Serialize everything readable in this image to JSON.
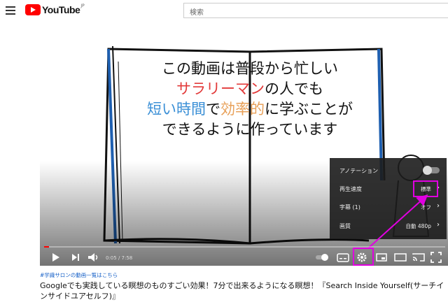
{
  "header": {
    "logo_text": "YouTube",
    "region": "JP",
    "search_placeholder": "検索"
  },
  "video": {
    "caption_lines": [
      [
        {
          "t": "この動画は普段から忙しい",
          "c": "black"
        }
      ],
      [
        {
          "t": "サラリーマン",
          "c": "red"
        },
        {
          "t": "の人でも",
          "c": "black"
        }
      ],
      [
        {
          "t": "短い時間",
          "c": "blue"
        },
        {
          "t": "で",
          "c": "black"
        },
        {
          "t": "効率的",
          "c": "orange"
        },
        {
          "t": "に学ぶことが",
          "c": "black"
        }
      ],
      [
        {
          "t": "できるように作っています",
          "c": "black"
        }
      ]
    ],
    "progress": 0.0127
  },
  "settings_menu": {
    "annotations_label": "アノテーション",
    "speed_label": "再生速度",
    "speed_value": "標準",
    "subtitles_label": "字幕 (1)",
    "subtitles_value": "オフ",
    "quality_label": "画質",
    "quality_value": "自動 480p"
  },
  "controls": {
    "time": "0:05 / 7:58"
  },
  "below_video": {
    "hashtag": "#学識サロンの動画一覧はこちら",
    "title": "Googleでも実践している瞑想のものすごい効果！7分で出来るようになる瞑想！『Search Inside Yourself(サーチインサイドユアセルフ)』"
  },
  "colors": {
    "highlight": "#e000e0",
    "progress": "#ff0000",
    "youtube_red": "#ff0000"
  }
}
